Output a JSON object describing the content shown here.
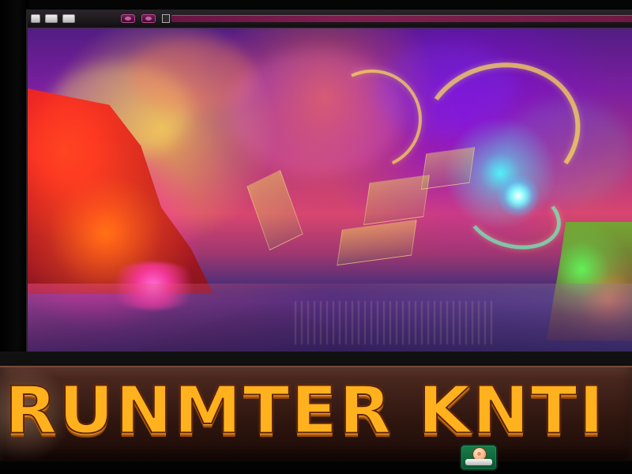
{
  "game": {
    "title": "RUNMTER KNTI"
  },
  "window": {
    "toolbar_icons": [
      "window-icon",
      "folder-icon",
      "window-icon",
      "record-icon",
      "record-icon",
      "stop-icon"
    ]
  },
  "colors": {
    "title_fill": "#ffb11e",
    "title_outline": "#5d2207",
    "banner_brown": "#3b1d14",
    "titlebar_magenta": "#7f1f4f",
    "button_green": "#187d48"
  }
}
